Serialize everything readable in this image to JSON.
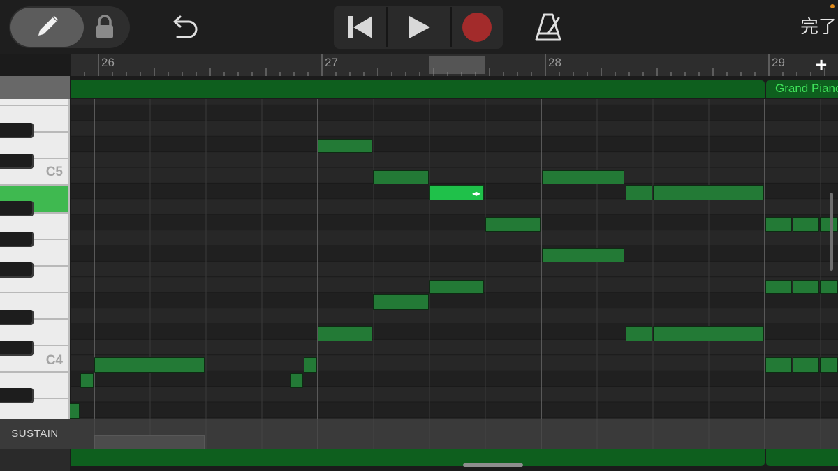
{
  "toolbar": {
    "tools": [
      "pencil",
      "lock"
    ],
    "icons": {
      "pencil": "pencil-icon",
      "lock": "lock-icon",
      "undo": "undo-icon",
      "rewind": "rewind-to-start-icon",
      "play": "play-icon",
      "record": "record-icon",
      "metronome": "metronome-icon"
    },
    "done_label": "完了",
    "record_color": "#a32b2b"
  },
  "ruler": {
    "bars": [
      {
        "label": "26"
      },
      {
        "label": "27"
      },
      {
        "label": "28"
      },
      {
        "label": "29"
      }
    ],
    "add_label": "+"
  },
  "region": {
    "name": "Grand Piano",
    "color": "#0e5f1e"
  },
  "keyboard": {
    "labels": [
      "C5",
      "C4"
    ],
    "active_color": "#3fb950"
  },
  "notes": {
    "fill": "#237a36",
    "selected_fill": "#1fc14a",
    "selected_icon": "resize-handle-icon"
  },
  "sustain": {
    "label": "SUSTAIN"
  }
}
